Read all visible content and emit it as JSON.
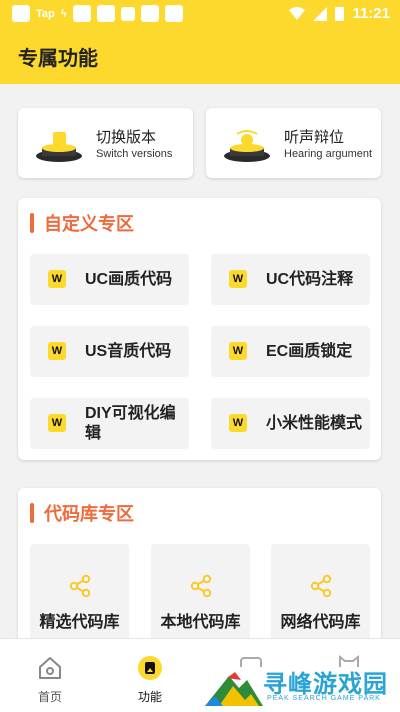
{
  "status_bar": {
    "left_label": "Tap",
    "time": "11:21"
  },
  "header": {
    "title": "专属功能"
  },
  "top_cards": [
    {
      "title": "切换版本",
      "subtitle": "Switch versions"
    },
    {
      "title": "听声辩位",
      "subtitle": "Hearing argument"
    }
  ],
  "custom_section": {
    "title": "自定义专区",
    "icon_letter": "W",
    "items": [
      {
        "label": "UC画质代码"
      },
      {
        "label": "UC代码注释"
      },
      {
        "label": "US音质代码"
      },
      {
        "label": "EC画质锁定"
      },
      {
        "label": "DIY可视化编辑"
      },
      {
        "label": "小米性能模式"
      }
    ]
  },
  "library_section": {
    "title": "代码库专区",
    "items": [
      {
        "label": "精选代码库"
      },
      {
        "label": "本地代码库"
      },
      {
        "label": "网络代码库"
      }
    ]
  },
  "bottom_nav": [
    {
      "label": "首页"
    },
    {
      "label": "功能"
    }
  ],
  "watermark": {
    "main": "寻峰游戏园",
    "sub": "PEAK SEARCH GAME PARK"
  },
  "colors": {
    "accent": "#fcd92c",
    "section_title": "#ef6a3c",
    "watermark": "#2aa3d6"
  }
}
